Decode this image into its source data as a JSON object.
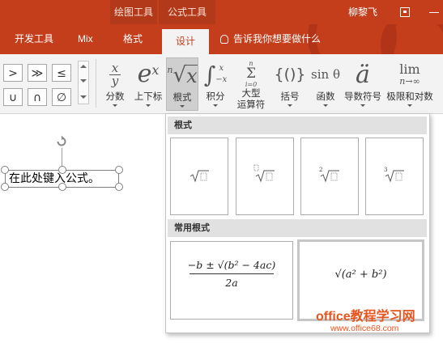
{
  "title_bar": {
    "context_tabs": [
      "绘图工具",
      "公式工具"
    ],
    "user_name": "柳黎飞"
  },
  "tabs": {
    "dev": "开发工具",
    "mix": "Mix",
    "format": "格式",
    "design": "设计",
    "tell_me": "告诉我你想要做什么"
  },
  "colors": {
    "brand": "#c43e1c",
    "watermark": "#e8541d",
    "selected_tab_bg": "#f3f3f3"
  },
  "symbols": [
    ">",
    "≫",
    "≤",
    "∪",
    "∩",
    "∅"
  ],
  "ribbon_buttons": [
    {
      "id": "fraction",
      "icon": "fraction-icon",
      "label": "分数"
    },
    {
      "id": "script",
      "icon": "script-icon",
      "label": "上下标"
    },
    {
      "id": "radical",
      "icon": "radical-icon",
      "label": "根式",
      "selected": true
    },
    {
      "id": "integral",
      "icon": "integral-icon",
      "label": "积分"
    },
    {
      "id": "large_operator",
      "icon": "large-operator-icon",
      "label": "大型",
      "label2": "运算符"
    },
    {
      "id": "bracket",
      "icon": "bracket-icon",
      "label": "括号"
    },
    {
      "id": "function",
      "icon": "function-icon",
      "label": "函数"
    },
    {
      "id": "accent",
      "icon": "accent-icon",
      "label": "导数符号"
    },
    {
      "id": "limit_log",
      "icon": "limit-icon",
      "label": "极限和对数"
    }
  ],
  "ribbon_icons": {
    "fraction_num": "x",
    "fraction_den": "y",
    "script_base": "e",
    "script_sup": "x",
    "radical_index": "n",
    "radical_arg": "x",
    "integral_sign": "∫",
    "integral_upper": "x",
    "integral_lower": "−x",
    "sum_upper": "n",
    "sum_sign": "Σ",
    "sum_lower": "i=0",
    "bracket_glyph": "{()}",
    "function_text": "sin θ",
    "accent_text": "ä",
    "lim_text": "lim",
    "lim_sub": "n→∞"
  },
  "document": {
    "formula_placeholder": "在此处键入公式。"
  },
  "dropdown": {
    "section_radicals": "根式",
    "section_common": "常用根式",
    "tiles": [
      {
        "kind": "square-root"
      },
      {
        "kind": "nth-root"
      },
      {
        "kind": "square-root-degree-2",
        "index": "2"
      },
      {
        "kind": "cube-root",
        "index": "3"
      }
    ],
    "common": {
      "quadratic_numerator": "−b ± √(b² − 4ac)",
      "quadratic_denominator": "2a",
      "pythagorean": "√(a² + b²)"
    }
  },
  "watermark": {
    "line1": "office教程学习网",
    "line2": "www.office68.com"
  }
}
